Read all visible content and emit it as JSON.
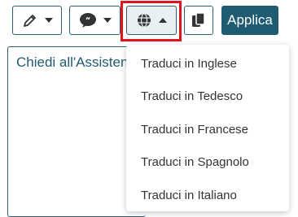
{
  "toolbar": {
    "edit_icon": "pencil-icon",
    "comment_icon": "speech-bubble-icon",
    "translate_icon": "globe-icon",
    "copy_icon": "copy-icon",
    "apply_label": "Applica"
  },
  "assistant": {
    "placeholder": "Chiedi all'Assistente"
  },
  "translate_menu": {
    "items": [
      "Traduci in Inglese",
      "Traduci in Tedesco",
      "Traduci in Francese",
      "Traduci in Spagnolo",
      "Traduci in Italiano"
    ]
  },
  "colors": {
    "accent": "#1f5c72",
    "highlight": "#e0141c"
  }
}
